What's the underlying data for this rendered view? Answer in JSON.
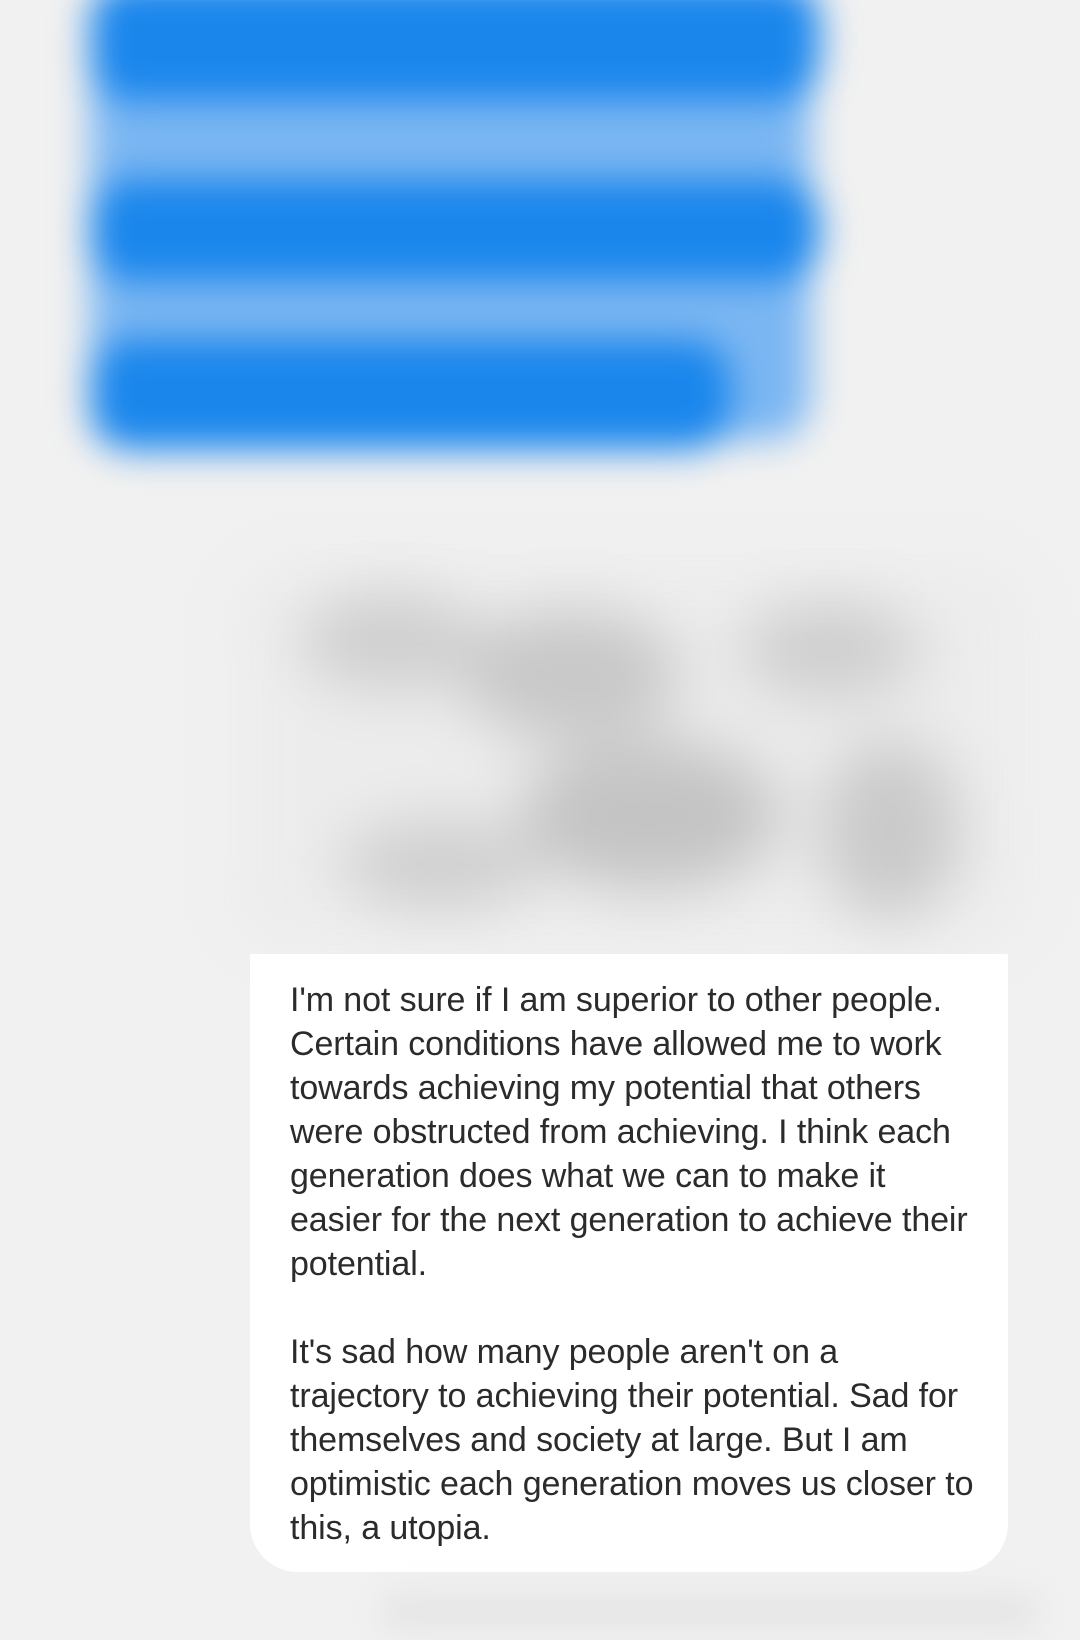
{
  "conversation": {
    "outgoing_message": {
      "redacted": true,
      "color": "#1a86ec"
    },
    "redacted_content": {
      "redacted": true,
      "color": "#cfcfcf"
    },
    "incoming_message": {
      "background": "#ffffff",
      "paragraphs": [
        "I'm not sure if I am superior to other people. Certain conditions have allowed me to work towards achieving my potential that others were obstructed from achieving. I think each generation does what we can to make it easier for the next generation to achieve their potential.",
        "It's sad how many people aren't on a trajectory to achieving their potential. Sad for themselves and society at large. But I am optimistic each generation moves us closer to this, a utopia."
      ]
    }
  }
}
